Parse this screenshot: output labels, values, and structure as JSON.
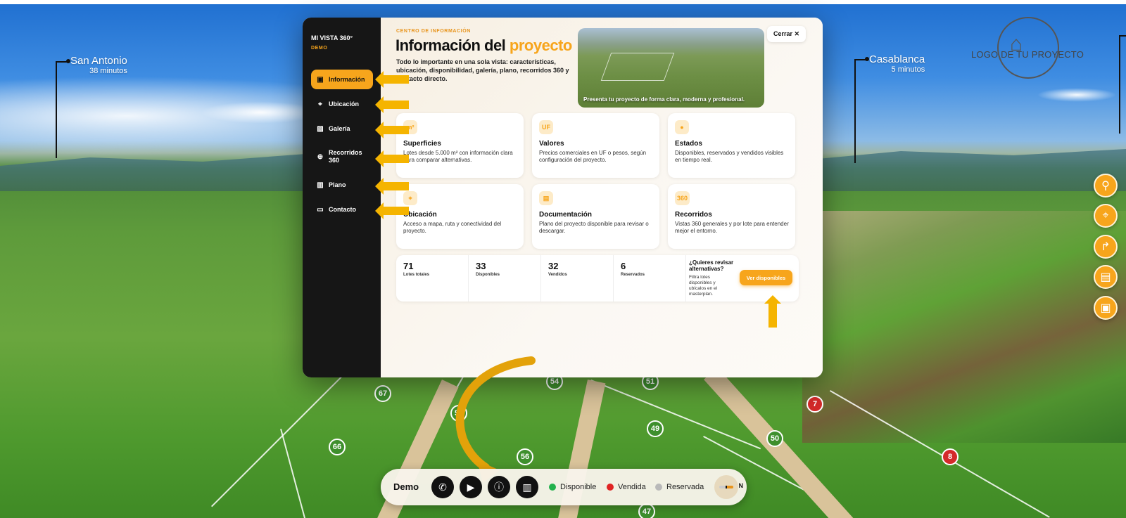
{
  "destinations": [
    {
      "name": "San Antonio",
      "time": "38 minutos"
    },
    {
      "name": "Casablanca",
      "time": "5 minutos"
    }
  ],
  "logo": {
    "text": "LOGO DE TU PROYECTO",
    "icon": "house-icon"
  },
  "lot_markers": [
    {
      "num": "67",
      "status": "available"
    },
    {
      "num": "57",
      "status": "available"
    },
    {
      "num": "54",
      "status": "available"
    },
    {
      "num": "51",
      "status": "available"
    },
    {
      "num": "49",
      "status": "available"
    },
    {
      "num": "50",
      "status": "available"
    },
    {
      "num": "66",
      "status": "available"
    },
    {
      "num": "56",
      "status": "available"
    },
    {
      "num": "47",
      "status": "available"
    },
    {
      "num": "7",
      "status": "sold"
    },
    {
      "num": "8",
      "status": "sold"
    }
  ],
  "side_tools": [
    "search-icon",
    "location-pin-icon",
    "route-icon",
    "document-icon",
    "image-icon"
  ],
  "modal": {
    "brand": "MI VISTA 360°",
    "brand_sub": "DEMO",
    "nav": [
      {
        "label": "Información",
        "icon": "info-icon",
        "active": true
      },
      {
        "label": "Ubicación",
        "icon": "location-pin-icon",
        "active": false
      },
      {
        "label": "Galería",
        "icon": "image-icon",
        "active": false
      },
      {
        "label": "Recorridos 360",
        "icon": "globe-icon",
        "active": false
      },
      {
        "label": "Plano",
        "icon": "map-icon",
        "active": false
      },
      {
        "label": "Contacto",
        "icon": "chat-icon",
        "active": false
      }
    ],
    "eyebrow": "CENTRO DE INFORMACIÓN",
    "title_main": "Información del ",
    "title_highlight": "proyecto",
    "lead": "Todo lo importante en una sola vista: características, ubicación, disponibilidad, galería, plano, recorridos 360 y contacto directo.",
    "hero_caption": "Presenta tu proyecto de forma clara, moderna y profesional.",
    "close_label": "Cerrar ✕",
    "cards": [
      {
        "badge": "m²",
        "title": "Superficies",
        "desc": "Lotes desde 5.000 m² con información clara para comparar alternativas."
      },
      {
        "badge": "UF",
        "title": "Valores",
        "desc": "Precios comerciales en UF o pesos, según configuración del proyecto."
      },
      {
        "badge": "●",
        "title": "Estados",
        "desc": "Disponibles, reservados y vendidos visibles en tiempo real."
      },
      {
        "badge": "⌖",
        "title": "Ubicación",
        "desc": "Acceso a mapa, ruta y conectividad del proyecto."
      },
      {
        "badge": "▤",
        "title": "Documentación",
        "desc": "Plano del proyecto disponible para revisar o descargar."
      },
      {
        "badge": "360",
        "title": "Recorridos",
        "desc": "Vistas 360 generales y por lote para entender mejor el entorno."
      }
    ],
    "stats": [
      {
        "value": "71",
        "label": "Lotes totales"
      },
      {
        "value": "33",
        "label": "Disponibles"
      },
      {
        "value": "32",
        "label": "Vendidos"
      },
      {
        "value": "6",
        "label": "Reservados"
      }
    ],
    "cta_question": "¿Quieres revisar alternativas?",
    "cta_desc": "Filtra lotes disponibles y ubícalos en el masterplan.",
    "cta_button": "Ver disponibles"
  },
  "bottom_bar": {
    "project": "Demo",
    "buttons": [
      "phone-icon",
      "play-icon",
      "info-icon",
      "map-icon"
    ],
    "legend": [
      {
        "label": "Disponible",
        "color": "#22b14c"
      },
      {
        "label": "Vendida",
        "color": "#e02424"
      },
      {
        "label": "Reservada",
        "color": "#b9b9b9"
      }
    ],
    "compass_label": "N"
  },
  "colors": {
    "accent": "#f7a51c",
    "sidebar": "#161616",
    "annotation": "#f5b400"
  }
}
